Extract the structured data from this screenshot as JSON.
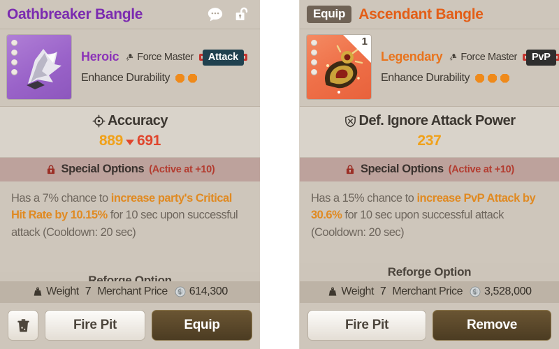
{
  "panels": [
    {
      "id": "left",
      "header": {
        "title": "Oathbreaker Bangle",
        "title_color": "#7b2bb0",
        "equip_badge": null,
        "icons": [
          {
            "name": "chat-bubble-icon",
            "label": "chat"
          },
          {
            "name": "unlock-icon",
            "label": "unlocked"
          }
        ]
      },
      "item": {
        "rarity": "Heroic",
        "rarity_color": "#8c34b8",
        "class_name": "Force Master",
        "class_icon": "force-master-icon",
        "tag": "Attack",
        "tag_color": "#20414f",
        "tag_annotated": true,
        "annotation_color": "#c4342f",
        "durability_label": "Enhance Durability",
        "durability_pips": 2,
        "durability_pip_color": "#ef8a1b",
        "slots": 4,
        "quantity": null,
        "thumb_style": "purple"
      },
      "stat": {
        "icon": "accuracy-icon",
        "name": "Accuracy",
        "new_value": "889",
        "new_color": "#f0a11a",
        "has_arrow": true,
        "arrow_direction": "down",
        "old_value": "691",
        "old_color": "#e0452c"
      },
      "special": {
        "icon": "lock-icon",
        "title": "Special Options",
        "condition": "(Active at +10)",
        "condition_color": "#b33c30",
        "description_parts": [
          {
            "text": "Has a 7% chance to ",
            "highlight": false
          },
          {
            "text": "increase party's Critical Hit Rate by 10.15%",
            "highlight": true
          },
          {
            "text": " for 10 sec upon successful attack (Cooldown: 20 sec)",
            "highlight": false
          }
        ]
      },
      "reforge_label": "Reforge Option",
      "reforge_clipped": true,
      "footer_info": {
        "weight_icon": "weight-icon",
        "weight_label": "Weight",
        "weight_value": "7",
        "price_label": "Merchant Price",
        "coin_icon": "silver-coin-icon",
        "price_value": "614,300"
      },
      "buttons": [
        {
          "name": "delete-button",
          "label": "",
          "icon": "trash-icon",
          "style": "icon"
        },
        {
          "name": "fire-pit-button",
          "label": "Fire Pit",
          "style": "light"
        },
        {
          "name": "equip-button",
          "label": "Equip",
          "style": "dark"
        }
      ]
    },
    {
      "id": "right",
      "header": {
        "title": "Ascendant Bangle",
        "title_color": "#e35e17",
        "equip_badge": "Equip",
        "icons": []
      },
      "item": {
        "rarity": "Legendary",
        "rarity_color": "#e9741d",
        "class_name": "Force Master",
        "class_icon": "force-master-icon",
        "tag": "PvP",
        "tag_color": "#2e2e2e",
        "tag_annotated": true,
        "annotation_color": "#c4342f",
        "durability_label": "Enhance Durability",
        "durability_pips": 3,
        "durability_pip_color": "#ef8a1b",
        "slots": 4,
        "quantity": "1",
        "thumb_style": "orange"
      },
      "stat": {
        "icon": "shield-icon",
        "name": "Def. Ignore Attack Power",
        "new_value": "237",
        "new_color": "#f0a11a",
        "has_arrow": false,
        "arrow_direction": null,
        "old_value": null,
        "old_color": null
      },
      "special": {
        "icon": "lock-icon",
        "title": "Special Options",
        "condition": "(Active at +10)",
        "condition_color": "#b33c30",
        "description_parts": [
          {
            "text": "Has a 15% chance to ",
            "highlight": false
          },
          {
            "text": "increase PvP Attack by 30.6%",
            "highlight": true
          },
          {
            "text": " for 10 sec upon successful attack (Cooldown: 20 sec)",
            "highlight": false
          }
        ]
      },
      "reforge_label": "Reforge Option",
      "reforge_clipped": false,
      "footer_info": {
        "weight_icon": "weight-icon",
        "weight_label": "Weight",
        "weight_value": "7",
        "price_label": "Merchant Price",
        "coin_icon": "silver-coin-icon",
        "price_value": "3,528,000"
      },
      "buttons": [
        {
          "name": "fire-pit-button",
          "label": "Fire Pit",
          "style": "light"
        },
        {
          "name": "remove-button",
          "label": "Remove",
          "style": "dark"
        }
      ]
    }
  ]
}
